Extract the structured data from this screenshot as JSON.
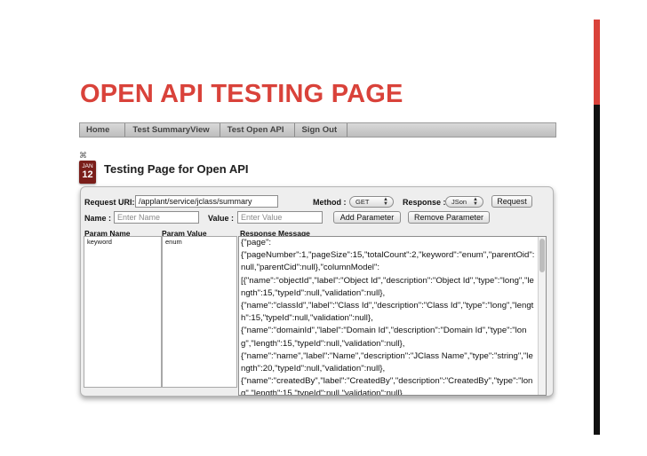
{
  "slide": {
    "title": "OPEN API TESTING PAGE"
  },
  "accent": {
    "red": "#d9423a",
    "black": "#111111"
  },
  "nav": {
    "items": [
      "Home",
      "Test SummaryView",
      "Test Open API",
      "Sign Out"
    ]
  },
  "date": {
    "month": "JAN",
    "day": "12"
  },
  "section": {
    "title": "Testing Page for Open API"
  },
  "form": {
    "request_uri_label": "Request URI:",
    "request_uri_value": "/applant/service/jclass/summary",
    "method_label": "Method :",
    "method_value": "GET",
    "response_label": "Response :",
    "response_value": "JSon",
    "request_button": "Request",
    "name_label": "Name :",
    "name_placeholder": "Enter Name",
    "value_label": "Value :",
    "value_placeholder": "Enter Value",
    "add_param_button": "Add Parameter",
    "remove_param_button": "Remove Parameter"
  },
  "params": {
    "col_name": "Param Name",
    "col_value": "Param Value",
    "col_response": "Response Message",
    "rows": [
      {
        "name": "keyword",
        "value": "enum"
      }
    ]
  },
  "response": {
    "text": "{\"page\":\n{\"pageNumber\":1,\"pageSize\":15,\"totalCount\":2,\"keyword\":\"enum\",\"parentOid\":null,\"parentCid\":null},\"columnModel\":\n[{\"name\":\"objectId\",\"label\":\"Object Id\",\"description\":\"Object Id\",\"type\":\"long\",\"length\":15,\"typeId\":null,\"validation\":null},\n{\"name\":\"classId\",\"label\":\"Class Id\",\"description\":\"Class Id\",\"type\":\"long\",\"length\":15,\"typeId\":null,\"validation\":null},\n{\"name\":\"domainId\",\"label\":\"Domain Id\",\"description\":\"Domain Id\",\"type\":\"long\",\"length\":15,\"typeId\":null,\"validation\":null},\n{\"name\":\"name\",\"label\":\"Name\",\"description\":\"JClass Name\",\"type\":\"string\",\"length\":20,\"typeId\":null,\"validation\":null},\n{\"name\":\"createdBy\",\"label\":\"CreatedBy\",\"description\":\"CreatedBy\",\"type\":\"long\",\"length\":15,\"typeId\":null,\"validation\":null},"
  }
}
